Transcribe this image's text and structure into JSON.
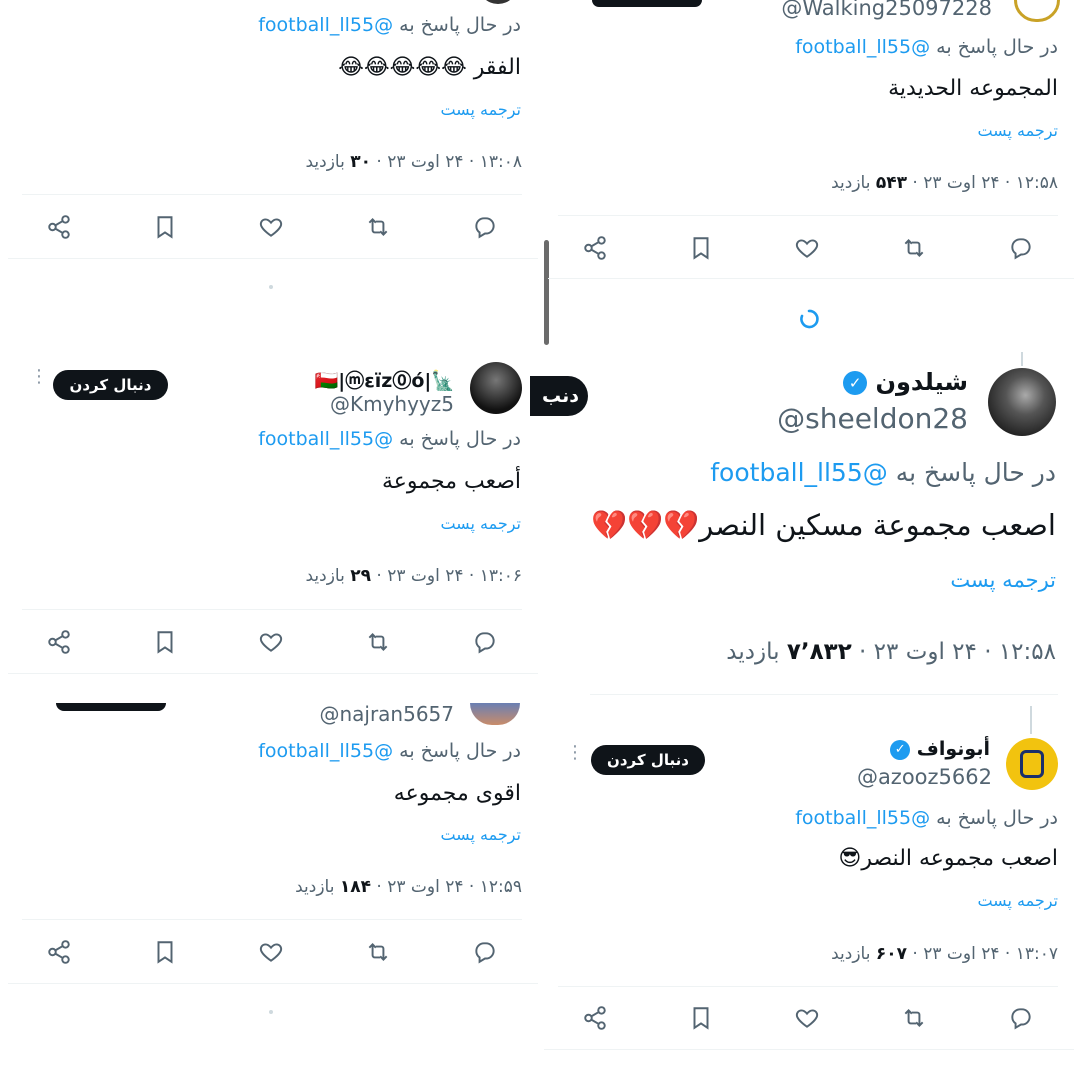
{
  "left": {
    "tweet1": {
      "reply_prefix": "در حال پاسخ به",
      "reply_mention": "@football_ll55",
      "text": "الفقر 😂😂😂😂😂",
      "translate": "ترجمه پست",
      "meta_time": "۱۳:۰۸ · ۲۴ اوت ۲۳ ·",
      "meta_views": "۳۰",
      "meta_suffix": "بازدید"
    },
    "tweet2": {
      "display_name": "🇴🇲|ⓜεïz⓪ó|🗽",
      "handle": "@Kmyhyyz5",
      "follow": "دنبال کردن",
      "reply_prefix": "در حال پاسخ به",
      "reply_mention": "@football_ll55",
      "text": "أصعب مجموعة",
      "translate": "ترجمه پست",
      "meta_time": "۱۳:۰۶ · ۲۴ اوت ۲۳ ·",
      "meta_views": "۲۹",
      "meta_suffix": "بازدید"
    },
    "tweet3": {
      "handle": "@najran5657",
      "reply_prefix": "در حال پاسخ به",
      "reply_mention": "@football_ll55",
      "text": "اقوى مجموعه",
      "translate": "ترجمه پست",
      "meta_time": "۱۲:۵۹ · ۲۴ اوت ۲۳ ·",
      "meta_views": "۱۸۴",
      "meta_suffix": "بازدید"
    }
  },
  "right": {
    "tweet1": {
      "handle": "@Walking25097228",
      "reply_prefix": "در حال پاسخ به",
      "reply_mention": "@football_ll55",
      "text": "المجموعه الحديدية",
      "translate": "ترجمه پست",
      "meta_time": "۱۲:۵۸ · ۲۴ اوت ۲۳ ·",
      "meta_views": "۵۴۳",
      "meta_suffix": "بازدید"
    },
    "main_tweet": {
      "display_name": "شيلدون",
      "handle": "@sheeldon28",
      "follow_partial": "دنب",
      "reply_prefix": "در حال پاسخ به",
      "reply_mention": "@football_ll55",
      "text": "اصعب مجموعة مسكين النصر💔💔💔",
      "translate": "ترجمه پست",
      "meta_time": "۱۲:۵۸ · ۲۴ اوت ۲۳ ·",
      "meta_views": "۷٬۸۳۲",
      "meta_suffix": "بازدید"
    },
    "tweet3": {
      "display_name": "أبونواف",
      "handle": "@azooz5662",
      "follow": "دنبال کردن",
      "reply_prefix": "در حال پاسخ به",
      "reply_mention": "@football_ll55",
      "text": "اصعب مجموعه النصر😎",
      "translate": "ترجمه پست",
      "meta_time": "۱۳:۰۷ · ۲۴ اوت ۲۳ ·",
      "meta_views": "۶۰۷",
      "meta_suffix": "بازدید"
    }
  },
  "colors": {
    "link": "#1d9bf0",
    "muted": "#536471",
    "text": "#0f1419",
    "divider": "#eff3f4",
    "button": "#0f1419"
  },
  "icons": [
    "reply-icon",
    "retweet-icon",
    "like-icon",
    "bookmark-icon",
    "share-icon",
    "verified-icon",
    "more-icon"
  ]
}
